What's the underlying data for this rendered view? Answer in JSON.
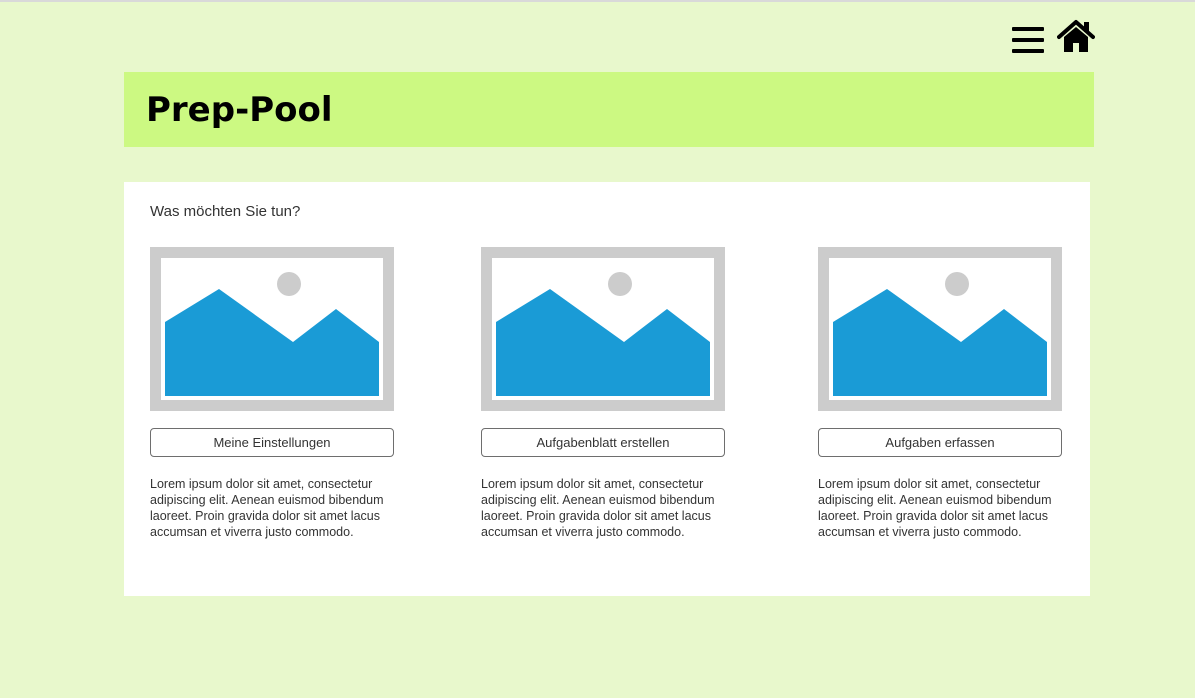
{
  "header": {
    "title": "Prep-Pool",
    "menu_icon": "hamburger-menu-icon",
    "home_icon": "home-icon"
  },
  "main": {
    "prompt": "Was möchten Sie tun?",
    "cards": [
      {
        "image": "image-placeholder-icon",
        "button_label": "Meine Einstellungen",
        "description": "Lorem ipsum dolor sit amet, consectetur adipiscing elit. Aenean euismod bibendum laoreet. Proin gravida dolor sit amet lacus accumsan et viverra justo commodo."
      },
      {
        "image": "image-placeholder-icon",
        "button_label": "Aufgabenblatt erstellen",
        "description": "Lorem ipsum dolor sit amet, consectetur adipiscing elit. Aenean euismod bibendum laoreet. Proin gravida dolor sit amet lacus accumsan et viverra justo commodo."
      },
      {
        "image": "image-placeholder-icon",
        "button_label": "Aufgaben erfassen",
        "description": "Lorem ipsum dolor sit amet, consectetur adipiscing elit. Aenean euismod bibendum laoreet. Proin gravida dolor sit amet lacus accumsan et viverra justo commodo."
      }
    ]
  },
  "colors": {
    "page_background": "#e8f8cc",
    "header_background": "#ccf982",
    "panel_background": "#ffffff",
    "placeholder_frame": "#cccccc",
    "placeholder_mountains": "#1a9bd6"
  }
}
